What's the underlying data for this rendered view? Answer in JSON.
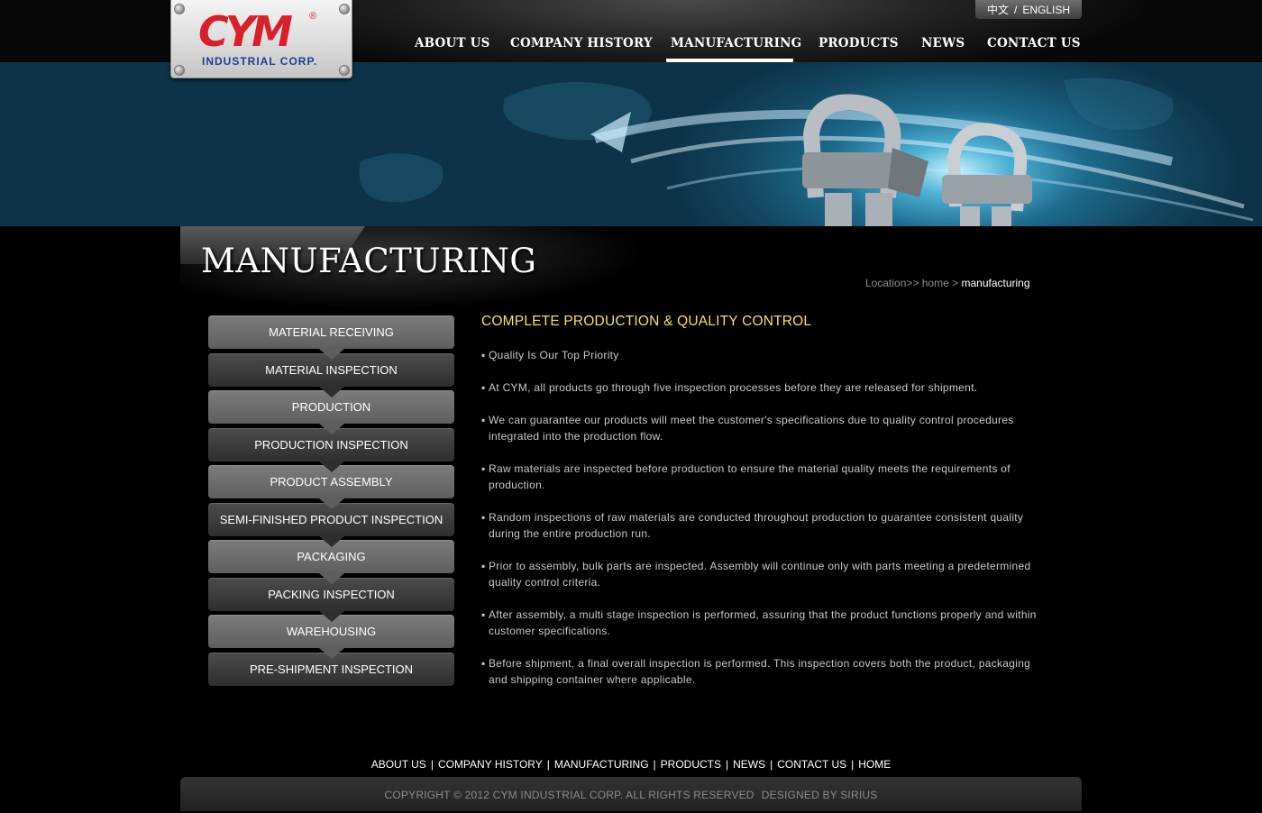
{
  "brand": {
    "logo_text": "CYM",
    "registered": "®",
    "sub": "INDUSTRIAL CORP."
  },
  "lang": {
    "zh": "中文",
    "sep": "/",
    "en": "ENGLISH"
  },
  "nav": {
    "about": "ABOUT US",
    "history": "COMPANY HISTORY",
    "manufacturing": "MANUFACTURING",
    "products": "PRODUCTS",
    "news": "NEWS",
    "contact": "CONTACT US",
    "active": "MANUFACTURING"
  },
  "page": {
    "title": "MANUFACTURING",
    "breadcrumb": {
      "prefix": "Location>>",
      "home": "home",
      "sep": ">",
      "current": "manufacturing"
    }
  },
  "sidebar": [
    "MATERIAL RECEIVING",
    "MATERIAL INSPECTION",
    "PRODUCTION",
    "PRODUCTION INSPECTION",
    "PRODUCT ASSEMBLY",
    "SEMI-FINISHED PRODUCT INSPECTION",
    "PACKAGING",
    "PACKING INSPECTION",
    "WAREHOUSING",
    "PRE-SHIPMENT INSPECTION"
  ],
  "content": {
    "heading": "COMPLETE PRODUCTION & QUALITY CONTROL",
    "bullet": "▪",
    "items": [
      "Quality Is Our Top Priority",
      "At CYM, all products go through five inspection processes before they are released for shipment.",
      "We can guarantee our products will meet the customer's specifications due to quality control procedures integrated into the production flow.",
      "Raw materials are inspected before production to ensure the material quality meets the requirements of production.",
      "Random inspections of raw materials are conducted throughout production to guarantee consistent quality during the entire production run.",
      "Prior to assembly, bulk parts are inspected. Assembly will continue only with parts meeting a predetermined quality control criteria.",
      "After assembly, a multi stage inspection is performed, assuring that the product functions properly and within customer specifications.",
      "Before shipment, a final overall inspection is performed. This inspection covers both the product, packaging and shipping container where applicable."
    ]
  },
  "footer": {
    "links": [
      "ABOUT US",
      "COMPANY HISTORY",
      "MANUFACTURING",
      "PRODUCTS",
      "NEWS",
      "CONTACT US",
      "HOME"
    ],
    "link_sep": "|",
    "copyright": "COPYRIGHT © 2012 CYM INDUSTRIAL CORP. ALL RIGHTS RESERVED",
    "designer": "DESIGNED BY SIRIUS"
  },
  "colors": {
    "heading_yellow": "#f5e25a",
    "logo_red": "#d9202a",
    "logo_blue": "#1c3f8f",
    "banner_blue": "#1d6a8d"
  }
}
